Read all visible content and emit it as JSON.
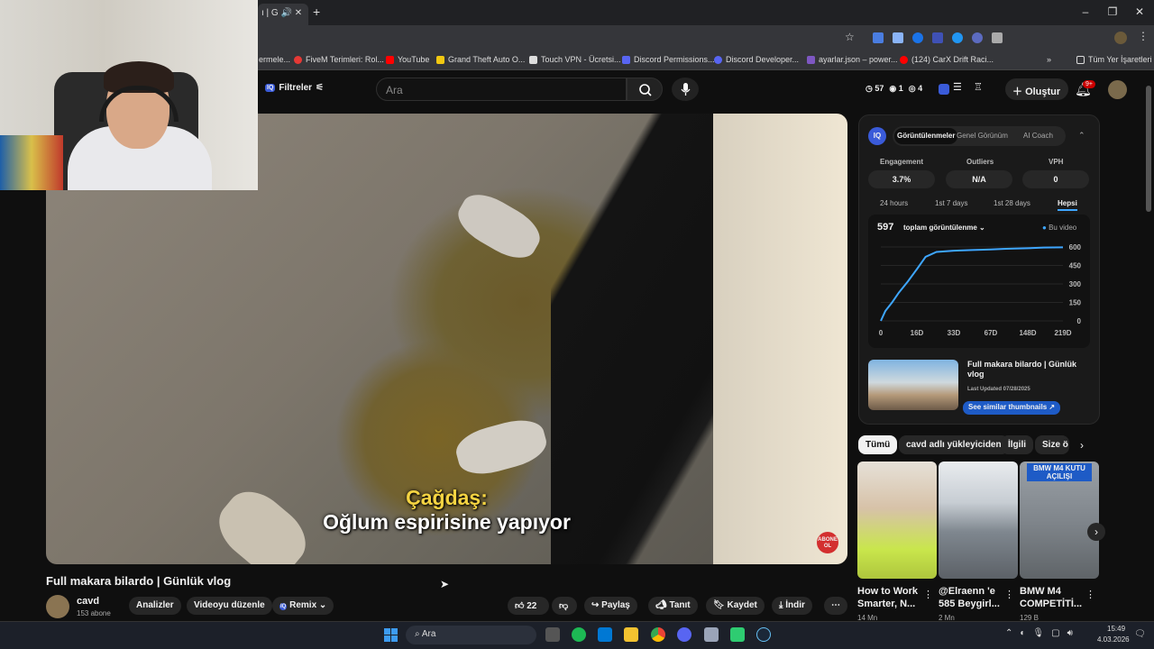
{
  "browser": {
    "tab_title": "ı | G",
    "bookmarks": [
      "ermelе...",
      "FiveM Terimleri: Rol...",
      "YouTube",
      "Grand Theft Auto O...",
      "Touch VPN - Ücretsi...",
      "Discord Permissions...",
      "Discord Developer...",
      "ayarlar.json – power...",
      "(124) CarX Drift Raci..."
    ],
    "all_bookmarks": "Tüm Yer İşaretleri"
  },
  "header": {
    "filters": "Filtreler",
    "search_placeholder": "Ara",
    "stat_views": "57",
    "stat_a": "1",
    "stat_b": "4",
    "create": "Oluştur",
    "notif_count": "9+"
  },
  "video": {
    "caption_speaker": "Çağdaş:",
    "caption_text": "Oğlum espirisine yapıyor",
    "subscribe_badge": "ABONE OL",
    "title": "Full makara bilardo | Günlük vlog"
  },
  "channel": {
    "name": "cavd",
    "subs": "153 abone",
    "analytics": "Analizler",
    "edit": "Videoyu düzenle",
    "remix": "Remix"
  },
  "actions": {
    "likes": "22",
    "share": "Paylaş",
    "promote": "Tanıt",
    "save": "Kaydet",
    "download": "İndir"
  },
  "panel": {
    "logo": "IQ",
    "tabs": [
      "Görüntülenmeler",
      "Genel Görünüm",
      "AI Coach"
    ],
    "stats": [
      {
        "label": "Engagement",
        "value": "3.7%"
      },
      {
        "label": "Outliers",
        "value": "N/A"
      },
      {
        "label": "VPH",
        "value": "0"
      }
    ],
    "ranges": [
      "24 hours",
      "1st 7 days",
      "1st 28 days",
      "Hepsi"
    ],
    "total": "597",
    "total_label": "toplam görüntülenme",
    "legend": "Bu video",
    "thumb_title": "Full makara bilardo | Günlük vlog",
    "last_updated": "Last Updated 07/28/2025",
    "similar": "See similar thumbnails"
  },
  "chart_data": {
    "type": "line",
    "x_ticks": [
      "0",
      "16D",
      "33D",
      "67D",
      "148D",
      "219D"
    ],
    "y_ticks": [
      "0",
      "150",
      "300",
      "450",
      "600"
    ],
    "ylim": [
      0,
      600
    ],
    "series": [
      {
        "name": "Bu video",
        "x": [
          0,
          2,
          5,
          8,
          12,
          16,
          20,
          25,
          33,
          50,
          67,
          100,
          148,
          180,
          219
        ],
        "values": [
          0,
          80,
          150,
          230,
          320,
          420,
          520,
          560,
          570,
          575,
          580,
          585,
          590,
          595,
          597
        ]
      }
    ]
  },
  "chips": [
    "Tümü",
    "cavd adlı yükleyiciden",
    "İlgili",
    "Size ö"
  ],
  "recs": [
    {
      "title": "How to Work Smarter, N...",
      "meta": "14 Mn"
    },
    {
      "title": "@Elraenn 'e 585 Beygirl...",
      "meta": "2 Mn"
    },
    {
      "title": "BMW M4 COMPETİTİ...",
      "meta": "129 B",
      "badge": "BMW M4 KUTU AÇILIŞI"
    }
  ],
  "taskbar": {
    "search": "Ara",
    "time": "15:49",
    "date": "4.03.2026"
  }
}
